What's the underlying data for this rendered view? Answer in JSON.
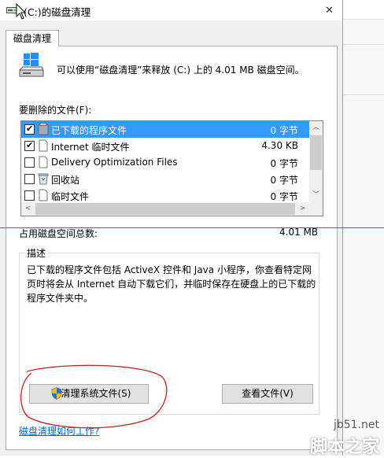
{
  "window": {
    "title": "(C:)的磁盘清理",
    "close_glyph": "✕"
  },
  "tab": {
    "label": "磁盘清理"
  },
  "intro_text": "可以使用“磁盘清理”来释放  (C:) 上的 4.01 MB 磁盘空间。",
  "files_to_delete_label": "要删除的文件(F):",
  "file_list": [
    {
      "name": "已下载的程序文件",
      "size": "0 字节",
      "checked": true,
      "icon": "folder-icon",
      "selected": true
    },
    {
      "name": "Internet 临时文件",
      "size": "4.30 KB",
      "checked": true,
      "icon": "document-icon",
      "selected": false
    },
    {
      "name": "Delivery Optimization Files",
      "size": "0 字节",
      "checked": false,
      "icon": "document-icon",
      "selected": false
    },
    {
      "name": "回收站",
      "size": "0 字节",
      "checked": false,
      "icon": "recycle-bin-icon",
      "selected": false
    },
    {
      "name": "临时文件",
      "size": "0 字节",
      "checked": false,
      "icon": "document-icon",
      "selected": false
    }
  ],
  "total": {
    "label": "占用磁盘空间总数:",
    "value": "4.01 MB"
  },
  "description": {
    "label": "描述",
    "text": "已下载的程序文件包括 ActiveX 控件和 Java 小程序，你查看特定网页时将会从 Internet 自动下载它们，并临时保存在硬盘上的已下载的程序文件夹中。"
  },
  "buttons": {
    "clean_system": "清理系统文件(S)",
    "view_files": "查看文件(V)"
  },
  "help_link": "磁盘清理如何工作?",
  "watermark": {
    "site": "jb51.net",
    "brand": "脚本之家"
  },
  "colors": {
    "selection": "#3399ff",
    "annotation_red": "#e0302c",
    "link": "#0066cc"
  }
}
